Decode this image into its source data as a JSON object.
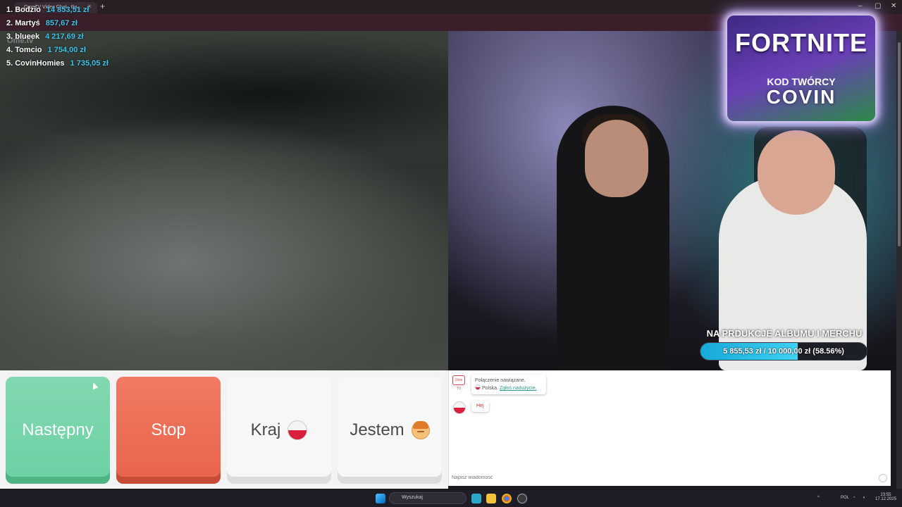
{
  "browser": {
    "tab_title": "OmeTV Video Chat - Ra...",
    "new_tab": "+",
    "tab_close": "×",
    "min": "–",
    "max": "▢",
    "close": "✕"
  },
  "leaderboard": [
    {
      "name": "1. Bodzio",
      "amount": "14 853,51 zł"
    },
    {
      "name": "2. Martyś",
      "amount": "857,67 zł"
    },
    {
      "name": "3. blueek",
      "amount": "4 217,69 zł"
    },
    {
      "name": "4. Tomcio",
      "amount": "1 754,00 zł"
    },
    {
      "name": "5. CovinHomies",
      "amount": "1 735,05 zł"
    }
  ],
  "ome_logo": "Ome.tv",
  "promo": {
    "title": "FORTNITE",
    "subtitle": "KOD TWÓRCY",
    "code": "COVIN"
  },
  "goal": {
    "title": "NA PRDUKCJE ALBUMU I MERCHU",
    "text": "5 855,53 zł / 10 000,00 zł (58.56%)",
    "progress": 0.5856
  },
  "controls": {
    "next": "Następny",
    "stop": "Stop",
    "country": "Kraj",
    "gender": "Jestem"
  },
  "chat": {
    "sys_logo": "Ome TV",
    "connected": "Połączenie nawiązane.",
    "country": "Polska.",
    "report": "Zgłoś nadużycie.",
    "message": "Hej",
    "input_placeholder": "Napisz wiadomość"
  },
  "taskbar": {
    "search": "Wyszukaj",
    "lang": "POL",
    "time": "23:55",
    "date": "17.12.2025"
  },
  "colors": {
    "next": "#6cd0a3",
    "stop": "#e8644c",
    "goal_fill": "#16a9d8",
    "leaderboard_amount": "#3fc4ea"
  }
}
